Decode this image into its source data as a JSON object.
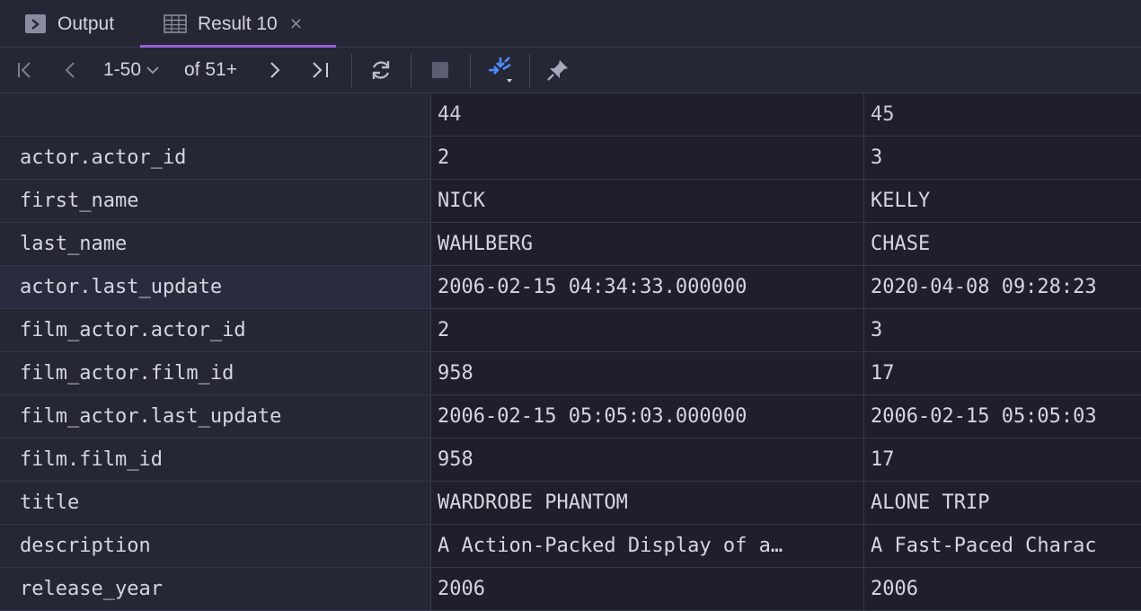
{
  "tabs": {
    "output_label": "Output",
    "result_label": "Result 10",
    "close_glyph": "×"
  },
  "toolbar": {
    "range": "1-50",
    "total": "of 51+",
    "accent_color": "#4f8cff"
  },
  "grid": {
    "column_headers": [
      "",
      "44",
      "45"
    ],
    "rows": [
      {
        "field": "actor.actor_id",
        "v1": "2",
        "v2": "3"
      },
      {
        "field": "first_name",
        "v1": "NICK",
        "v2": "KELLY"
      },
      {
        "field": "last_name",
        "v1": "WAHLBERG",
        "v2": "CHASE"
      },
      {
        "field": "actor.last_update",
        "v1": "2006-02-15 04:34:33.000000",
        "v2": "2020-04-08 09:28:23"
      },
      {
        "field": "film_actor.actor_id",
        "v1": "2",
        "v2": "3"
      },
      {
        "field": "film_actor.film_id",
        "v1": "958",
        "v2": "17"
      },
      {
        "field": "film_actor.last_update",
        "v1": "2006-02-15 05:05:03.000000",
        "v2": "2006-02-15 05:05:03"
      },
      {
        "field": "film.film_id",
        "v1": "958",
        "v2": "17"
      },
      {
        "field": "title",
        "v1": "WARDROBE PHANTOM",
        "v2": "ALONE TRIP"
      },
      {
        "field": "description",
        "v1": "A Action-Packed Display of a…",
        "v2": "A Fast-Paced Charac"
      },
      {
        "field": "release_year",
        "v1": "2006",
        "v2": "2006"
      }
    ]
  }
}
